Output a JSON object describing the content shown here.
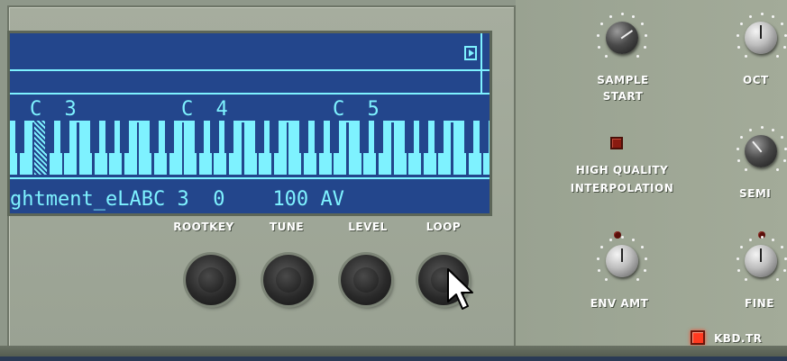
{
  "lcd": {
    "note_labels": [
      "C 3",
      "C 4",
      "C 5"
    ],
    "sample_name": "ghtment_eLAB",
    "rootkey": "C 3",
    "tune": "0",
    "level": "100",
    "loop": "AV"
  },
  "sample_controls": {
    "rootkey_label": "ROOTKEY",
    "tune_label": "TUNE",
    "level_label": "LEVEL",
    "loop_label": "LOOP"
  },
  "right_panel": {
    "sample_start_line1": "SAMPLE",
    "sample_start_line2": "START",
    "octave_label": "OCT",
    "hq_line1": "HIGH QUALITY",
    "hq_line2": "INTERPOLATION",
    "semi_label": "SEMI",
    "env_amt_label": "ENV AMT",
    "fine_label": "FINE",
    "kbd_track_label": "KBD.TR"
  },
  "colors": {
    "lcd_background": "#23468c",
    "lcd_text": "#7ef2ff",
    "led_on": "#ff3a20",
    "led_off": "#8a1a10"
  }
}
